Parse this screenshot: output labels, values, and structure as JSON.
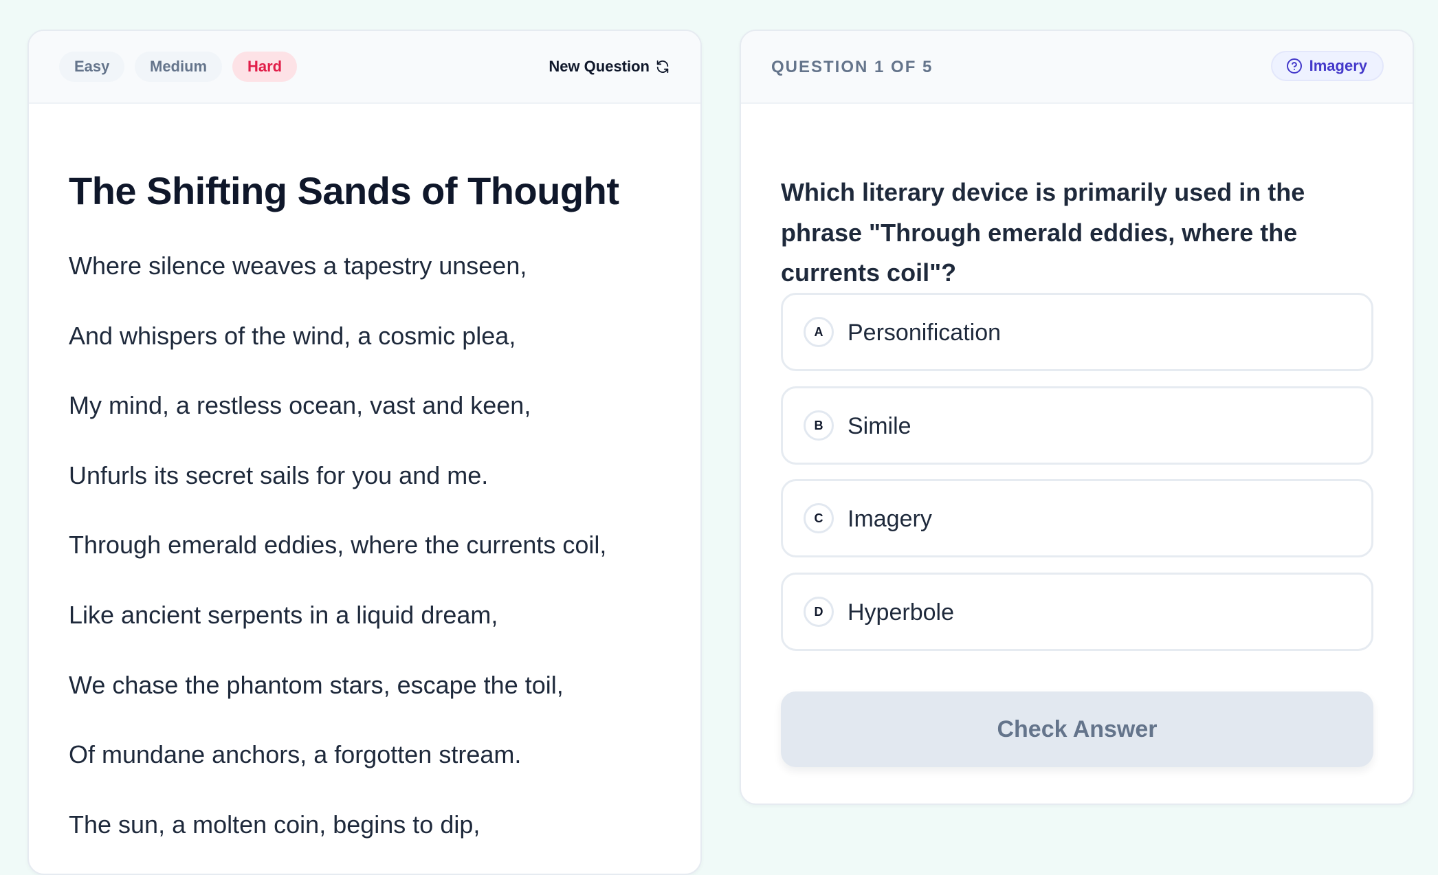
{
  "difficulty": {
    "options": [
      "Easy",
      "Medium",
      "Hard"
    ],
    "selected": "Hard"
  },
  "new_question_label": "New Question",
  "poem": {
    "title": "The Shifting Sands of Thought",
    "lines": [
      "Where silence weaves a tapestry unseen,",
      "And whispers of the wind, a cosmic plea,",
      "My mind, a restless ocean, vast and keen,",
      "Unfurls its secret sails for you and me.",
      "Through emerald eddies, where the currents coil,",
      "Like ancient serpents in a liquid dream,",
      "We chase the phantom stars, escape the toil,",
      "Of mundane anchors, a forgotten stream.",
      "The sun, a molten coin, begins to dip,"
    ]
  },
  "quiz": {
    "counter": "QUESTION 1 OF 5",
    "topic": "Imagery",
    "question": "Which literary device is primarily used in the phrase \"Through emerald eddies, where the currents coil\"?",
    "options": [
      {
        "letter": "A",
        "label": "Personification"
      },
      {
        "letter": "B",
        "label": "Simile"
      },
      {
        "letter": "C",
        "label": "Imagery"
      },
      {
        "letter": "D",
        "label": "Hyperbole"
      }
    ],
    "check_label": "Check Answer"
  },
  "colors": {
    "background": "#f0faf8",
    "hard_accent": "#e11d48",
    "topic_accent": "#4338ca",
    "button_disabled": "#e2e8f0"
  },
  "icons": {
    "refresh": "refresh-icon",
    "topic": "question-circle-icon"
  }
}
